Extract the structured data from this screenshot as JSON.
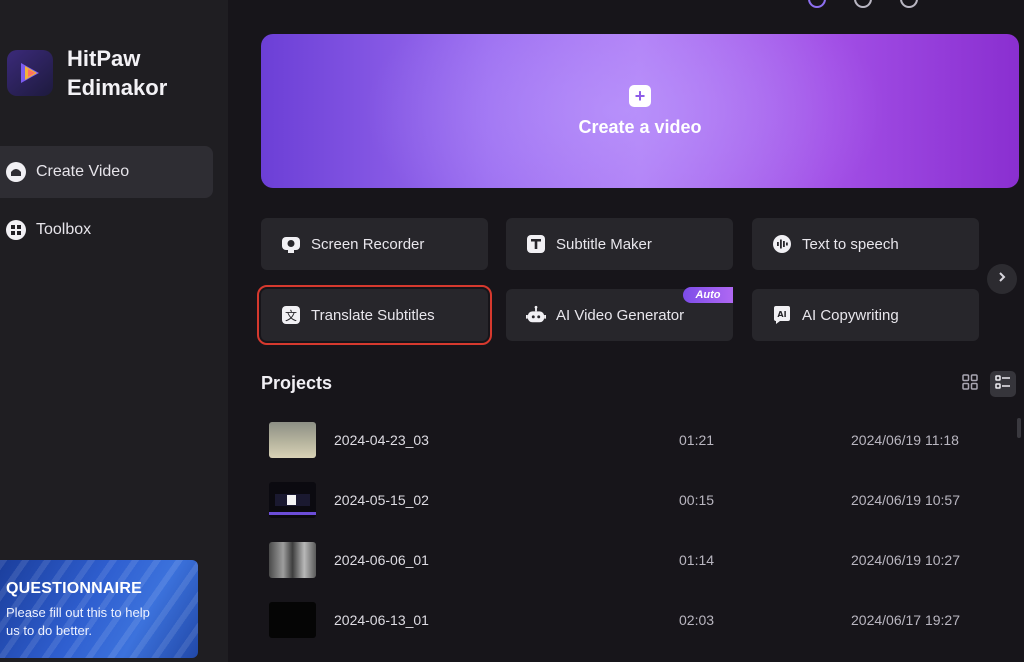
{
  "app": {
    "brand_line1": "HitPaw",
    "brand_line2": "Edimakor"
  },
  "sidebar": {
    "items": [
      {
        "label": "Create Video",
        "icon": "home-icon",
        "active": true
      },
      {
        "label": "Toolbox",
        "icon": "toolbox-icon",
        "active": false
      }
    ]
  },
  "questionnaire": {
    "title": "QUESTIONNAIRE",
    "text": "Please fill out this to help us to do better."
  },
  "hero": {
    "label": "Create a video",
    "icon": "plus-icon"
  },
  "tools": [
    {
      "label": "Screen Recorder",
      "icon": "camera-icon"
    },
    {
      "label": "Subtitle Maker",
      "icon": "text-t-icon"
    },
    {
      "label": "Text to speech",
      "icon": "audio-wave-icon"
    },
    {
      "label": "Translate Subtitles",
      "icon": "translate-icon",
      "selected": true
    },
    {
      "label": "AI Video Generator",
      "icon": "robot-icon",
      "badge": "Auto"
    },
    {
      "label": "AI Copywriting",
      "icon": "ai-icon"
    }
  ],
  "projects": {
    "title": "Projects",
    "rows": [
      {
        "name": "2024-04-23_03",
        "duration": "01:21",
        "modified": "2024/06/19 11:18"
      },
      {
        "name": "2024-05-15_02",
        "duration": "00:15",
        "modified": "2024/06/19 10:57"
      },
      {
        "name": "2024-06-06_01",
        "duration": "01:14",
        "modified": "2024/06/19 10:27"
      },
      {
        "name": "2024-06-13_01",
        "duration": "02:03",
        "modified": "2024/06/17 19:27"
      }
    ]
  },
  "colors": {
    "accent": "#9a6cf0",
    "selection_outline": "#d6392e",
    "background": "#17151a",
    "sidebar": "#1f1e22"
  }
}
